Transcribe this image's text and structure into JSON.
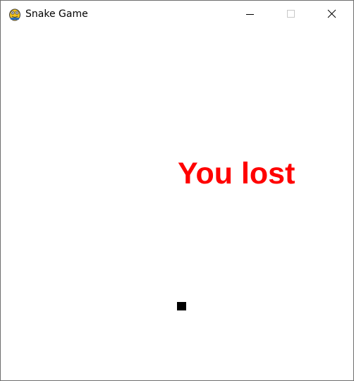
{
  "window": {
    "title": "Snake Game",
    "app_icon": "pygame-snake-icon",
    "controls": {
      "minimize_icon": "minimize-icon",
      "maximize_icon": "maximize-icon",
      "close_icon": "close-icon"
    }
  },
  "game": {
    "status_message": "You lost",
    "status_color": "#ff0000",
    "snake_color": "#000000",
    "background_color": "#ffffff"
  }
}
